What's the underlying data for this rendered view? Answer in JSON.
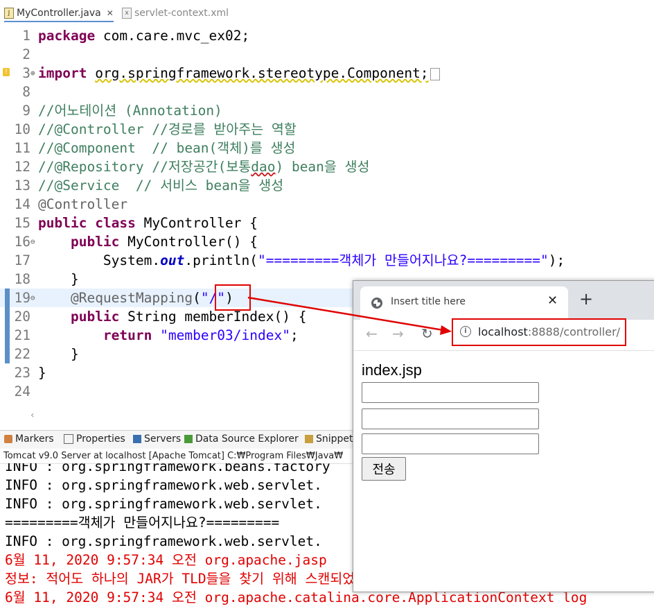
{
  "editor_tabs": [
    {
      "label": "MyController.java",
      "icon": "java-file-icon",
      "close": "✕"
    },
    {
      "label": "servlet-context.xml",
      "icon": "xml-file-icon"
    }
  ],
  "code_lines": [
    {
      "num": "1",
      "html": "<span class=\"kw\">package</span> com.care.mvc_ex02;"
    },
    {
      "num": "2",
      "html": ""
    },
    {
      "num": "3",
      "html": "<span class=\"kw\">import</span> <span class=\"sq\">org.springframework.stereotype.Component;</span><span class=\"collapsed-box\"></span>",
      "fold": "⊕",
      "warn": true
    },
    {
      "num": "8",
      "html": ""
    },
    {
      "num": "9",
      "html": "<span class=\"cm\">//어노테이션 (Annotation)</span>"
    },
    {
      "num": "10",
      "html": "<span class=\"cm\">//@Controller //경로를 받아주는 역할</span>"
    },
    {
      "num": "11",
      "html": "<span class=\"cm\">//@Component  // bean(객체)를 생성</span>"
    },
    {
      "num": "12",
      "html": "<span class=\"cm\">//@Repository //저장공간(보통<span class=\"sqr\">dao</span>) bean을 생성</span>"
    },
    {
      "num": "13",
      "html": "<span class=\"cm\">//@Service  // 서비스 bean을 생성</span>"
    },
    {
      "num": "14",
      "html": "<span class=\"ann\">@Controller</span>"
    },
    {
      "num": "15",
      "html": "<span class=\"kw\">public</span> <span class=\"kw\">class</span> MyController {"
    },
    {
      "num": "16",
      "html": "    <span class=\"kw\">public</span> MyController() {",
      "fold": "⊖"
    },
    {
      "num": "17",
      "html": "        System.<span class=\"fld\">out</span>.println(<span class=\"str\">\"=========객체가 만들어지나요?=========\"</span>);"
    },
    {
      "num": "18",
      "html": "    }"
    },
    {
      "num": "19",
      "html": "    <span class=\"ann\">@RequestMapping</span>(<span class=\"str\">\"/\"</span>)",
      "fold": "⊖",
      "hl": true
    },
    {
      "num": "20",
      "html": "    <span class=\"kw\">public</span> String memberIndex() {"
    },
    {
      "num": "21",
      "html": "        <span class=\"kw\">return</span> <span class=\"str\">\"member03/index\"</span>;"
    },
    {
      "num": "22",
      "html": "    }"
    },
    {
      "num": "23",
      "html": "}"
    },
    {
      "num": "24",
      "html": ""
    }
  ],
  "views_tabs": [
    {
      "label": "Markers",
      "icon": "markers-icon"
    },
    {
      "label": "Properties",
      "icon": "properties-icon"
    },
    {
      "label": "Servers",
      "icon": "servers-icon"
    },
    {
      "label": "Data Source Explorer",
      "icon": "data-source-icon"
    },
    {
      "label": "Snippets",
      "icon": "snippets-icon"
    }
  ],
  "console_title": "Tomcat v9.0 Server at localhost [Apache Tomcat] C:₩Program Files₩Java₩",
  "console_lines": [
    {
      "text": "INFO : org.springframework.beans.factory",
      "red": false
    },
    {
      "text": "INFO : org.springframework.web.servlet.",
      "red": false
    },
    {
      "text": "INFO : org.springframework.web.servlet.",
      "red": false
    },
    {
      "text": "=========객체가 만들어지나요?=========",
      "red": false
    },
    {
      "text": "INFO : org.springframework.web.servlet.",
      "red": false
    },
    {
      "text": "6월 11, 2020 9:57:34 오전 org.apache.jasp",
      "red": true
    },
    {
      "text": "정보: 적어도 하나의 JAR가 TLD들을 찾기 위해 스캔되었",
      "red": true
    },
    {
      "text": "6월 11, 2020 9:57:34 오전 org.apache.catalina.core.ApplicationContext log",
      "red": true
    }
  ],
  "browser": {
    "tab_title": "Insert title here",
    "tab_close": "✕",
    "new_tab": "+",
    "nav": {
      "back": "←",
      "forward": "→",
      "reload": "↻"
    },
    "info_icon": "i",
    "url_host": "localhost",
    "url_rest": ":8888/controller/",
    "page": {
      "heading": "index.jsp",
      "inputs": 3,
      "submit": "전송"
    }
  },
  "colors": {
    "annotation": "#e00000",
    "keyword": "#7f0055",
    "comment": "#3f7f5f",
    "string": "#2a00ff"
  }
}
